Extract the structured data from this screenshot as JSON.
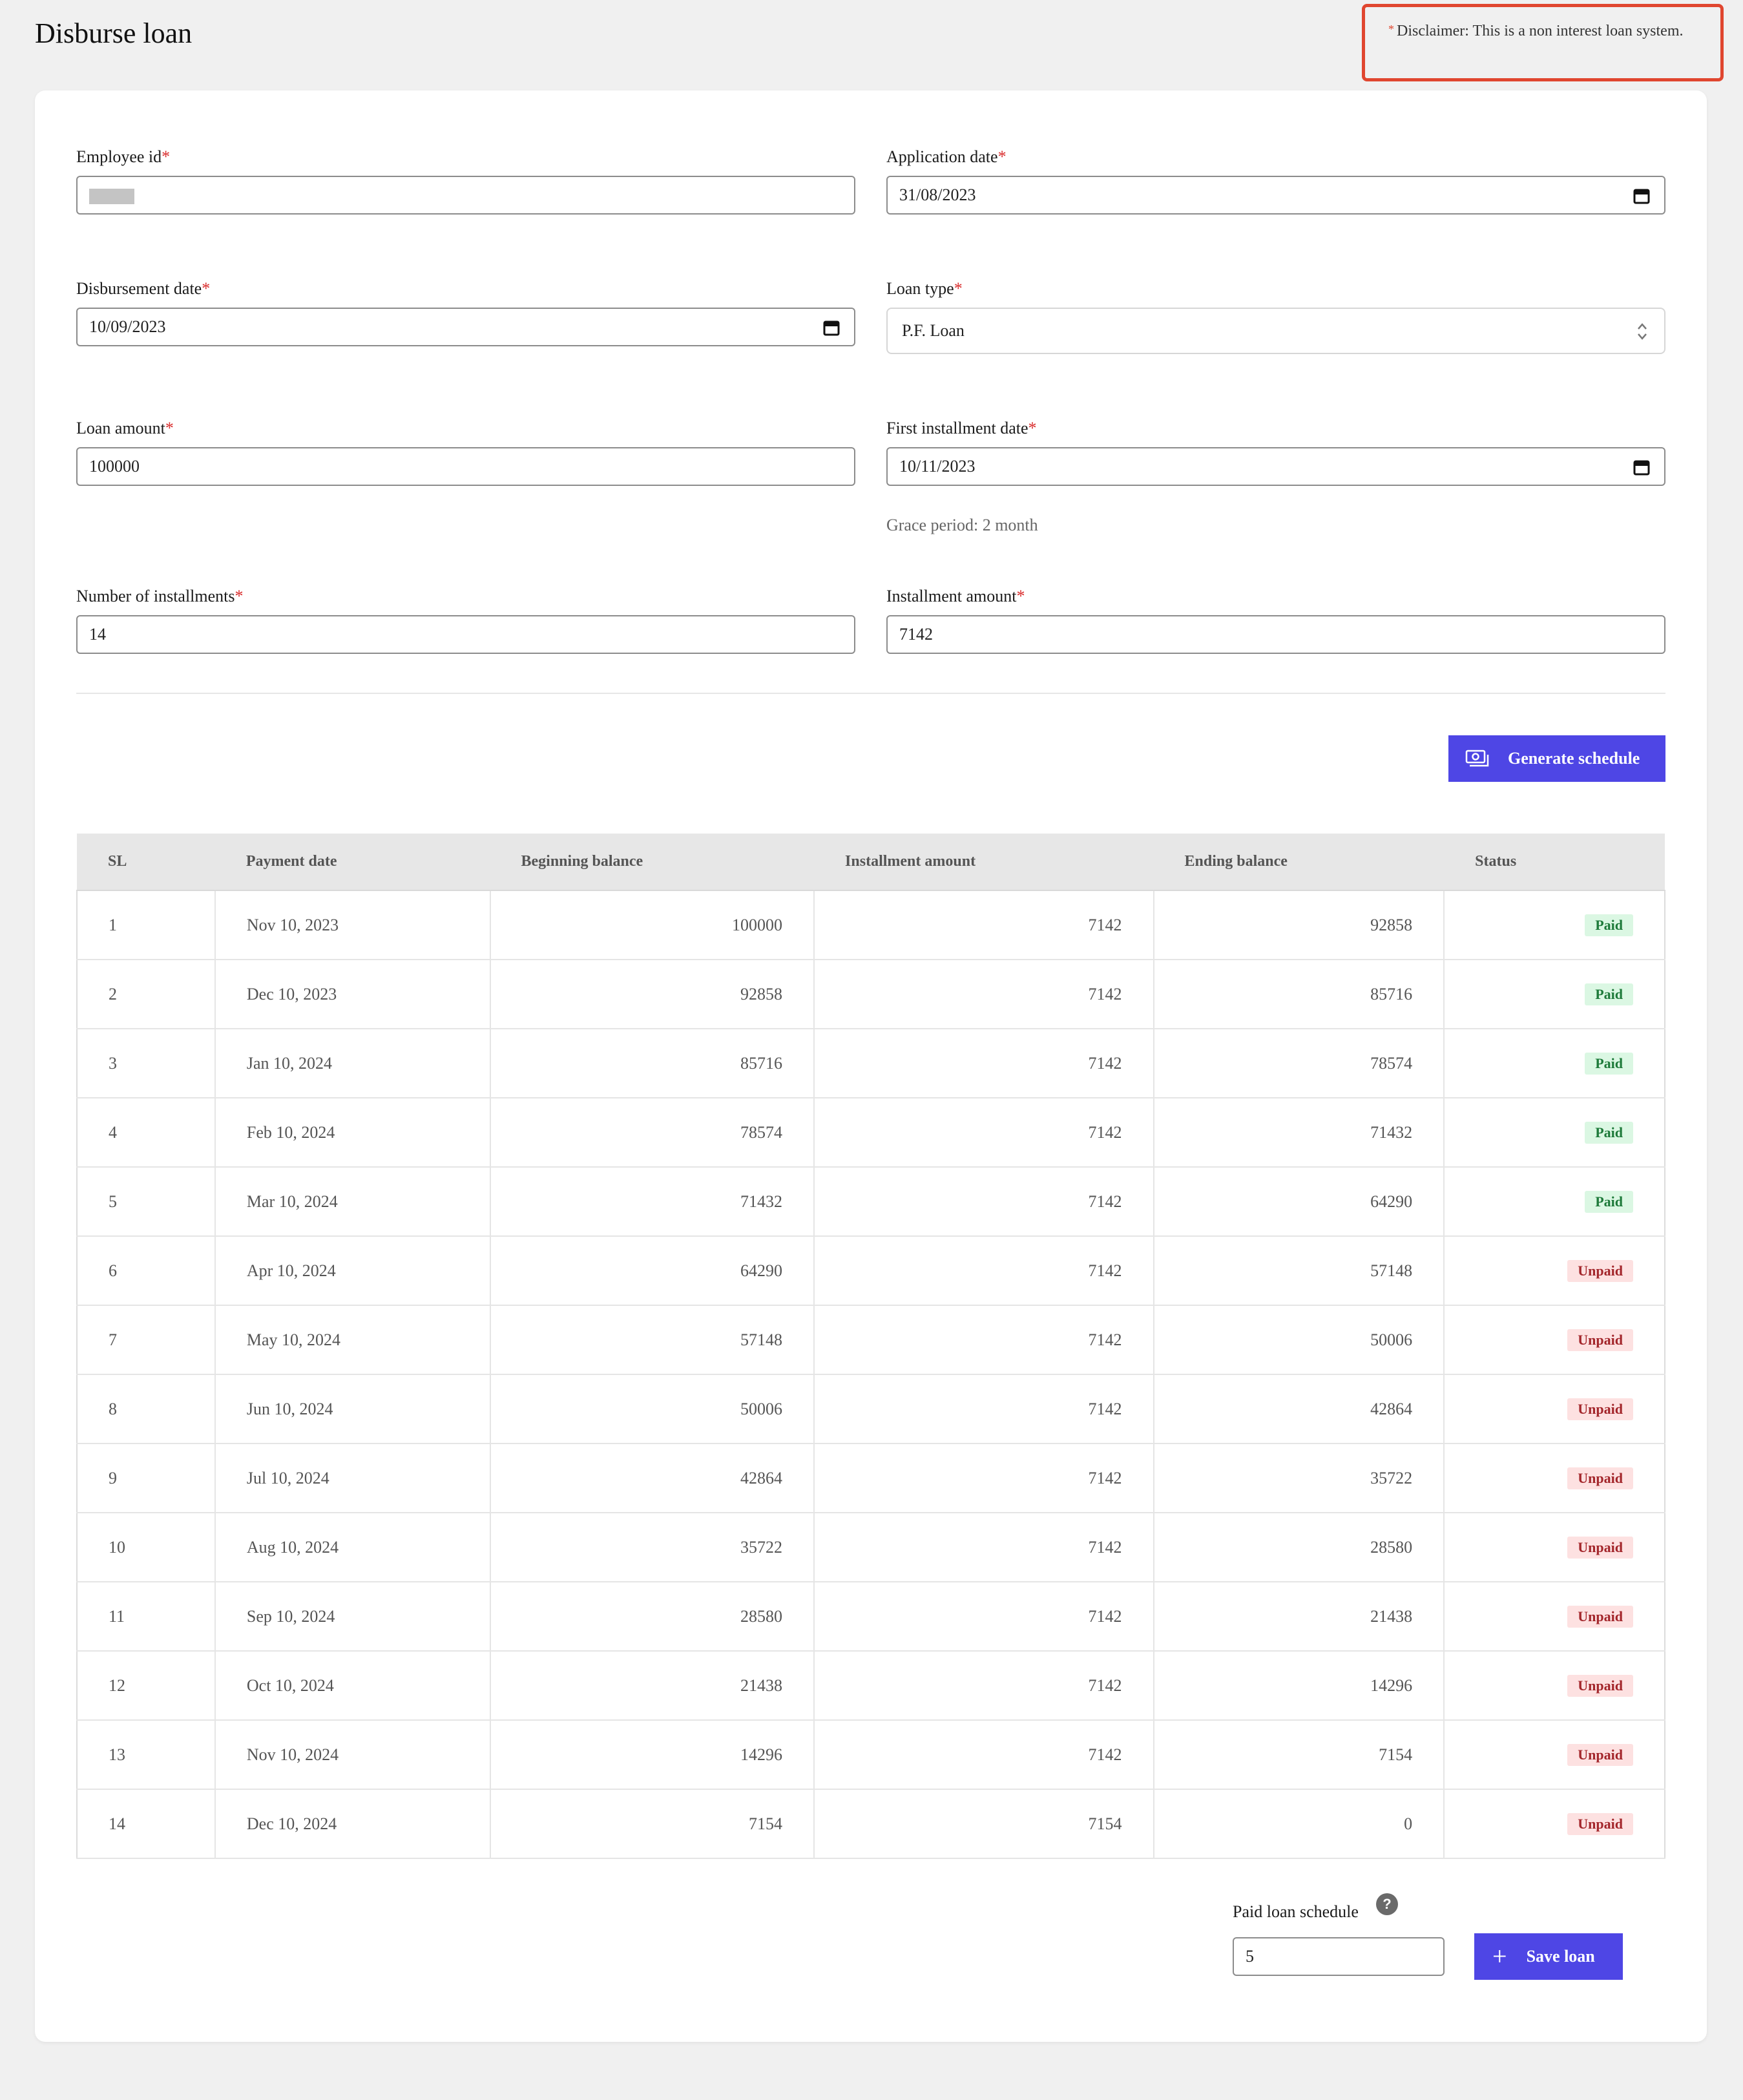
{
  "header": {
    "title": "Disburse loan",
    "disclaimer_marker": "*",
    "disclaimer": "Disclaimer: This is a non interest loan system."
  },
  "form": {
    "required_marker": "*",
    "employee_id": {
      "label": "Employee id",
      "value": ""
    },
    "application_date": {
      "label": "Application date",
      "value": "31/08/2023",
      "icon": "calendar-icon"
    },
    "disbursement_date": {
      "label": "Disbursement date",
      "value": "10/09/2023",
      "icon": "calendar-icon"
    },
    "loan_type": {
      "label": "Loan type",
      "value": "P.F. Loan",
      "icon": "select-arrows-icon"
    },
    "loan_amount": {
      "label": "Loan amount",
      "value": "100000"
    },
    "first_installment_date": {
      "label": "First installment date",
      "value": "10/11/2023",
      "hint": "Grace period: 2 month",
      "icon": "calendar-icon"
    },
    "number_of_installments": {
      "label": "Number of installments",
      "value": "14"
    },
    "installment_amount": {
      "label": "Installment amount",
      "value": "7142"
    }
  },
  "actions": {
    "generate_label": "Generate schedule",
    "generate_icon": "money-icon",
    "save_label": "Save loan",
    "save_icon": "plus-icon",
    "primary_color": "#4e46e5"
  },
  "schedule": {
    "columns": [
      "SL",
      "Payment date",
      "Beginning balance",
      "Installment amount",
      "Ending balance",
      "Status"
    ],
    "rows": [
      {
        "sl": "1",
        "date": "Nov 10, 2023",
        "begin": "100000",
        "installment": "7142",
        "end": "92858",
        "status": "Paid"
      },
      {
        "sl": "2",
        "date": "Dec 10, 2023",
        "begin": "92858",
        "installment": "7142",
        "end": "85716",
        "status": "Paid"
      },
      {
        "sl": "3",
        "date": "Jan 10, 2024",
        "begin": "85716",
        "installment": "7142",
        "end": "78574",
        "status": "Paid"
      },
      {
        "sl": "4",
        "date": "Feb 10, 2024",
        "begin": "78574",
        "installment": "7142",
        "end": "71432",
        "status": "Paid"
      },
      {
        "sl": "5",
        "date": "Mar 10, 2024",
        "begin": "71432",
        "installment": "7142",
        "end": "64290",
        "status": "Paid"
      },
      {
        "sl": "6",
        "date": "Apr 10, 2024",
        "begin": "64290",
        "installment": "7142",
        "end": "57148",
        "status": "Unpaid"
      },
      {
        "sl": "7",
        "date": "May 10, 2024",
        "begin": "57148",
        "installment": "7142",
        "end": "50006",
        "status": "Unpaid"
      },
      {
        "sl": "8",
        "date": "Jun 10, 2024",
        "begin": "50006",
        "installment": "7142",
        "end": "42864",
        "status": "Unpaid"
      },
      {
        "sl": "9",
        "date": "Jul 10, 2024",
        "begin": "42864",
        "installment": "7142",
        "end": "35722",
        "status": "Unpaid"
      },
      {
        "sl": "10",
        "date": "Aug 10, 2024",
        "begin": "35722",
        "installment": "7142",
        "end": "28580",
        "status": "Unpaid"
      },
      {
        "sl": "11",
        "date": "Sep 10, 2024",
        "begin": "28580",
        "installment": "7142",
        "end": "21438",
        "status": "Unpaid"
      },
      {
        "sl": "12",
        "date": "Oct 10, 2024",
        "begin": "21438",
        "installment": "7142",
        "end": "14296",
        "status": "Unpaid"
      },
      {
        "sl": "13",
        "date": "Nov 10, 2024",
        "begin": "14296",
        "installment": "7142",
        "end": "7154",
        "status": "Unpaid"
      },
      {
        "sl": "14",
        "date": "Dec 10, 2024",
        "begin": "7154",
        "installment": "7154",
        "end": "0",
        "status": "Unpaid"
      }
    ]
  },
  "paid_schedule": {
    "label": "Paid loan schedule",
    "help": "?",
    "value": "5"
  }
}
